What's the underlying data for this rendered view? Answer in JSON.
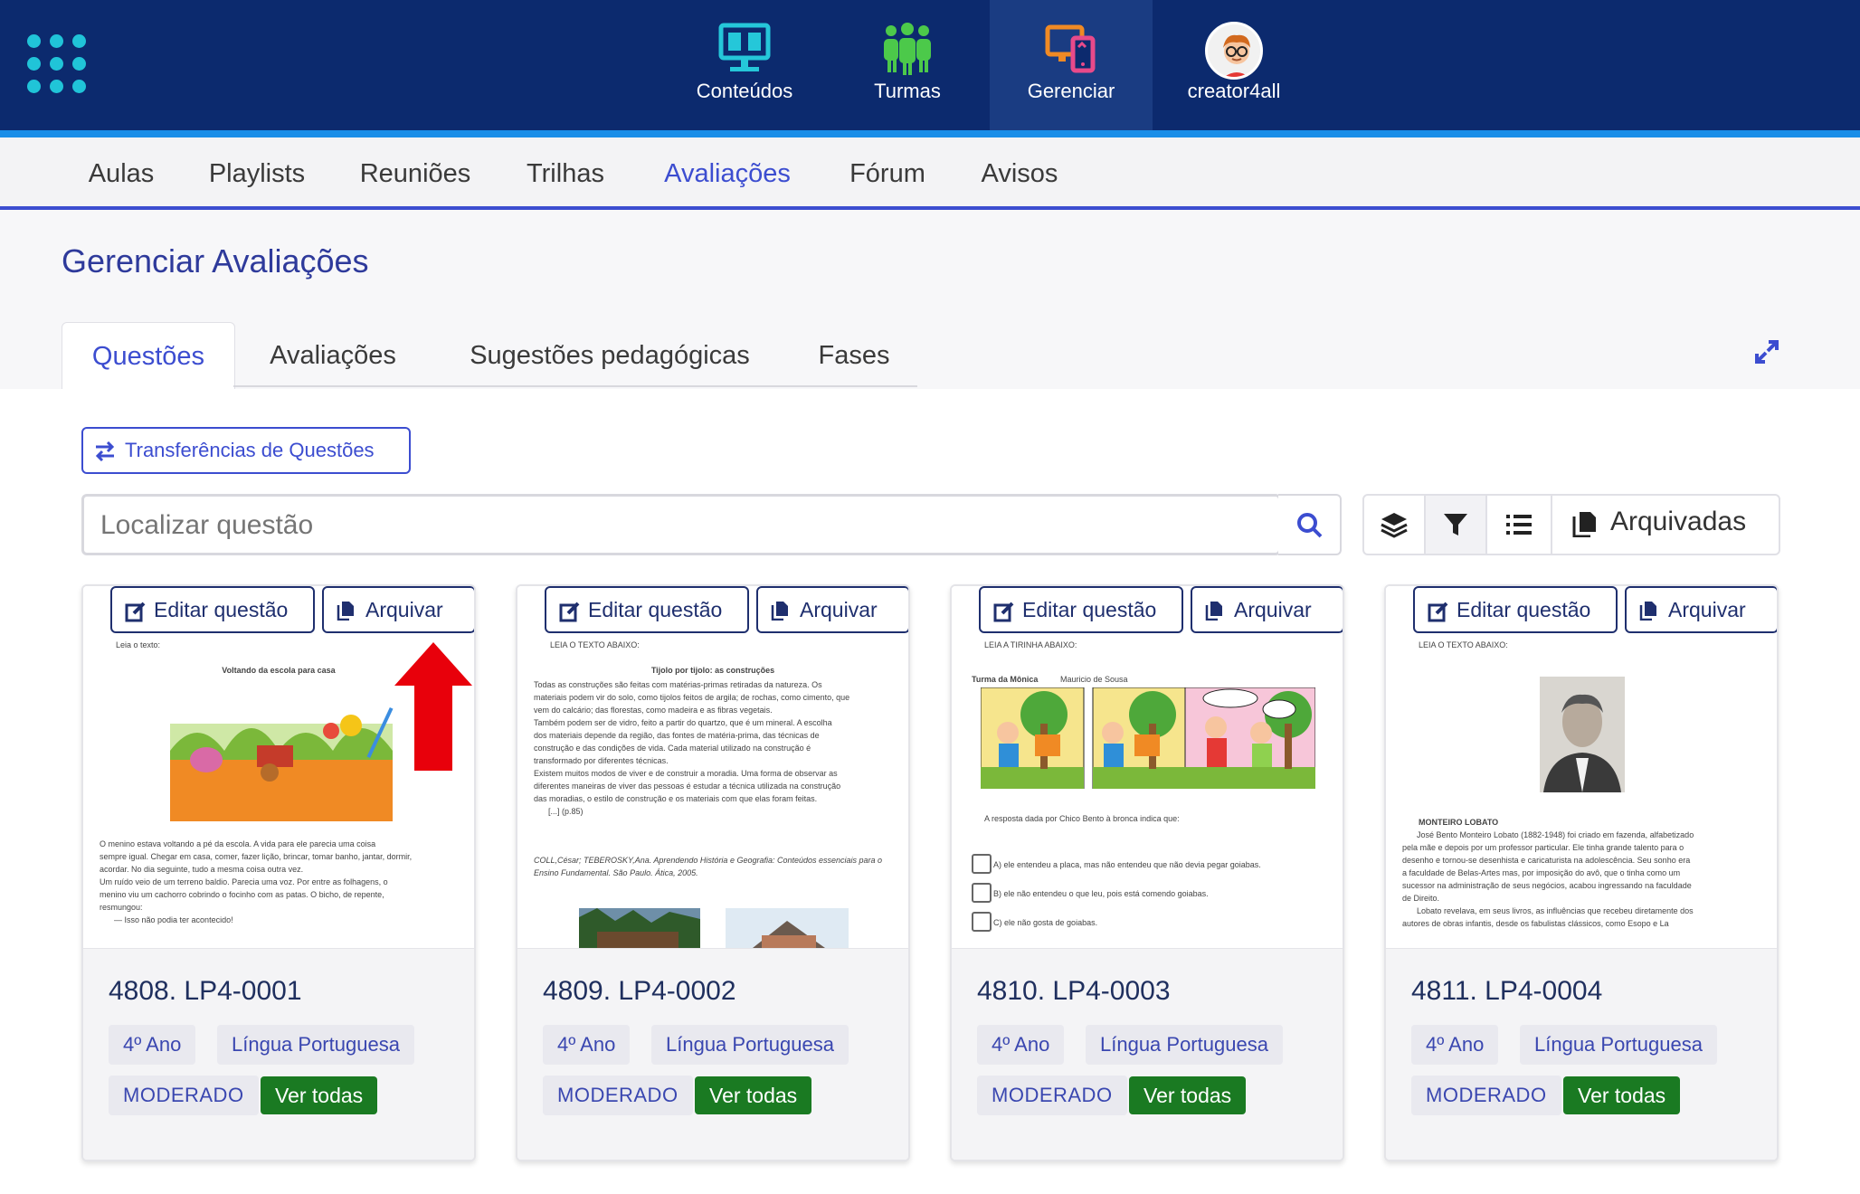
{
  "topnav": {
    "items": [
      {
        "label": "Conteúdos",
        "icon": "monitor-book-icon"
      },
      {
        "label": "Turmas",
        "icon": "people-icon"
      },
      {
        "label": "Gerenciar",
        "icon": "devices-icon"
      },
      {
        "label": "creator4all",
        "icon": "avatar"
      }
    ],
    "active": "Gerenciar"
  },
  "subnav": {
    "tabs": [
      "Aulas",
      "Playlists",
      "Reuniões",
      "Trilhas",
      "Avaliações",
      "Fórum",
      "Avisos"
    ],
    "active": "Avaliações"
  },
  "page": {
    "title": "Gerenciar Avaliações",
    "tabs": [
      "Questões",
      "Avaliações",
      "Sugestões pedagógicas",
      "Fases"
    ],
    "active_tab": "Questões"
  },
  "transfer_button": "Transferências de Questões",
  "search": {
    "placeholder": "Localizar questão"
  },
  "toolbar": {
    "archived_label": "Arquivadas"
  },
  "card_buttons": {
    "edit": "Editar questão",
    "archive": "Arquivar"
  },
  "colors": {
    "topbar": "#0c2a6e",
    "accent": "#3c4dd0",
    "green": "#1a7a22"
  },
  "cards": [
    {
      "code": "4808. LP4-0001",
      "grade": "4º Ano",
      "subject": "Língua Portuguesa",
      "status": "MODERADO",
      "link": "Ver todas",
      "preview": {
        "heading": "Leia o texto:",
        "title": "Voltando da escola para casa",
        "lines": [
          "O menino estava voltando a pé da escola. A vida para ele parecia uma coisa",
          "sempre igual. Chegar em casa, comer, fazer lição, brincar, tomar banho, jantar, dormir,",
          "acordar. No dia seguinte, tudo a mesma coisa outra vez.",
          "Um ruído veio de um terreno baldio. Parecia uma voz. Por entre as folhagens, o",
          "menino viu um cachorro cobrindo o focinho com as patas. O bicho, de repente,",
          "resmungou:",
          "— Isso não podia ter acontecido!"
        ]
      }
    },
    {
      "code": "4809. LP4-0002",
      "grade": "4º Ano",
      "subject": "Língua Portuguesa",
      "status": "MODERADO",
      "link": "Ver todas",
      "preview": {
        "heading": "LEIA O TEXTO ABAIXO:",
        "title": "Tijolo por tijolo: as construções",
        "lines": [
          "Todas as construções são feitas com matérias-primas retiradas da natureza. Os",
          "materiais podem vir do solo, como tijolos feitos de argila; de rochas, como cimento, que",
          "vem do calcário; das florestas, como madeira e as fibras vegetais.",
          "Também podem ser de vidro, feito a partir do quartzo, que é um mineral. A escolha",
          "dos materiais depende da região, das fontes de matéria-prima, das técnicas de",
          "construção e das condições de vida. Cada material utilizado na construção é",
          "transformado por diferentes técnicas.",
          "Existem muitos modos de viver e de construir a moradia. Uma forma de observar as",
          "diferentes maneiras de viver das pessoas é estudar a técnica utilizada na construção",
          "das moradias, o estilo de construção e os materiais com que elas foram feitas.",
          "[...] (p.85)"
        ],
        "source": "COLL,César; TEBEROSKY,Ana. Aprendendo História e Geografia: Conteúdos essenciais para o Ensino Fundamental. São Paulo. Ática, 2005."
      }
    },
    {
      "code": "4810. LP4-0003",
      "grade": "4º Ano",
      "subject": "Língua Portuguesa",
      "status": "MODERADO",
      "link": "Ver todas",
      "preview": {
        "heading": "LEIA A TIRINHA ABAIXO:",
        "title": "Turma da Mônica",
        "author": "Mauricio de Sousa",
        "question": "A resposta dada por Chico Bento à bronca indica que:",
        "options": [
          "A) ele entendeu a placa, mas não entendeu que não devia pegar goiabas.",
          "B) ele não entendeu o que leu, pois está comendo goiabas.",
          "C) ele não gosta de goiabas."
        ]
      }
    },
    {
      "code": "4811. LP4-0004",
      "grade": "4º Ano",
      "subject": "Língua Portuguesa",
      "status": "MODERADO",
      "link": "Ver todas",
      "preview": {
        "heading": "LEIA O TEXTO ABAIXO:",
        "title": "MONTEIRO LOBATO",
        "lines": [
          "José Bento Monteiro Lobato (1882-1948) foi criado em fazenda, alfabetizado",
          "pela mãe e depois por um professor particular. Ele tinha grande talento para o",
          "desenho e tornou-se desenhista e caricaturista na adolescência. Seu sonho era",
          "a faculdade de Belas-Artes mas, por imposição do avô, que o tinha como um",
          "sucessor na administração de seus negócios, acabou ingressando na faculdade",
          "de Direito.",
          "Lobato revelava, em seus livros, as influências que recebeu diretamente dos",
          "autores de obras infantis, desde os fabulistas clássicos, como Esopo e La"
        ]
      }
    }
  ]
}
